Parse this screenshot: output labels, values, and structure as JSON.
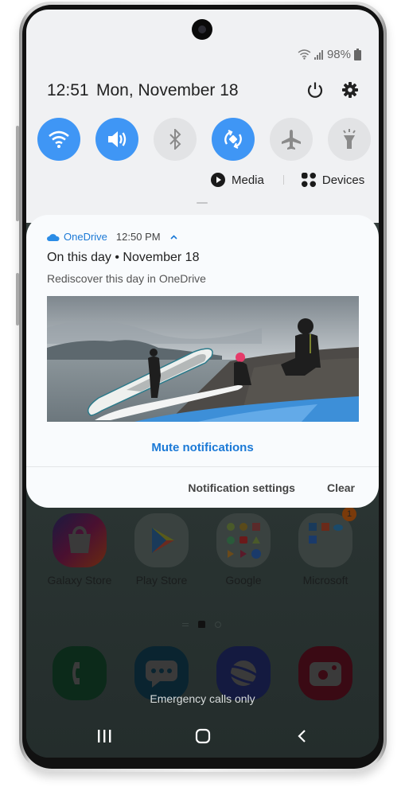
{
  "status_bar": {
    "battery": "98%",
    "icons": [
      "wifi-icon",
      "signal-icon",
      "battery-icon"
    ]
  },
  "quick_panel": {
    "time": "12:51",
    "date": "Mon, November 18",
    "header_icons": [
      "power-icon",
      "settings-gear-icon"
    ],
    "accent_color": "#3f96f5",
    "tiles": [
      {
        "name": "wifi",
        "icon": "wifi-icon",
        "state": "on"
      },
      {
        "name": "sound",
        "icon": "volume-icon",
        "state": "on"
      },
      {
        "name": "bluetooth",
        "icon": "bluetooth-icon",
        "state": "off"
      },
      {
        "name": "auto-rotate",
        "icon": "auto-rotate-icon",
        "state": "on"
      },
      {
        "name": "airplane-mode",
        "icon": "airplane-icon",
        "state": "off"
      },
      {
        "name": "flashlight",
        "icon": "flashlight-icon",
        "state": "off"
      }
    ],
    "media_label": "Media",
    "devices_label": "Devices"
  },
  "notification": {
    "app_name": "OneDrive",
    "time": "12:50 PM",
    "title": "On this day • November 18",
    "subtitle": "Rediscover this day in OneDrive",
    "image_description": "Three women in wetsuits with paddleboards on a rocky beach by the water",
    "mute_label": "Mute notifications",
    "settings_label": "Notification settings",
    "clear_label": "Clear",
    "brand_color": "#1b79d6"
  },
  "home_screen": {
    "apps": [
      {
        "label": "Galaxy Store"
      },
      {
        "label": "Play Store"
      },
      {
        "label": "Google"
      },
      {
        "label": "Microsoft",
        "badge": "1"
      }
    ],
    "dock": [
      "phone-icon",
      "messages-icon",
      "internet-icon",
      "camera-icon"
    ],
    "emergency_text": "Emergency calls only"
  },
  "nav_bar": [
    "recents-button",
    "home-button",
    "back-button"
  ]
}
